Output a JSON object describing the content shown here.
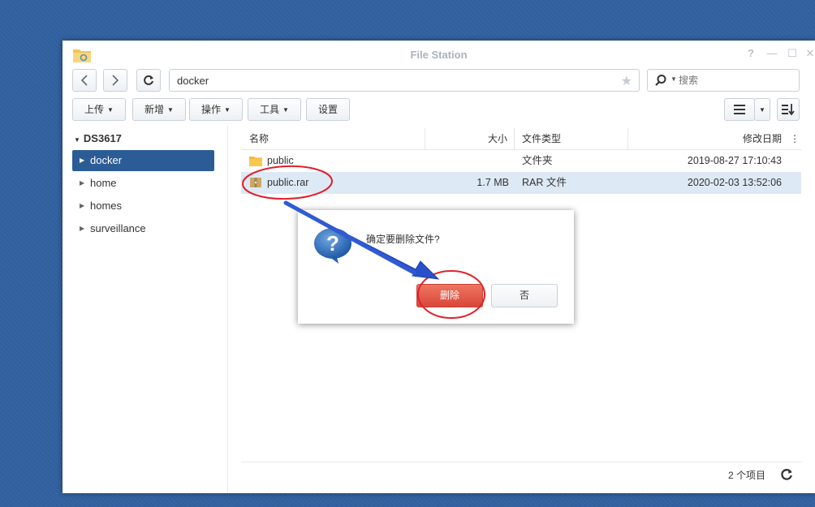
{
  "window": {
    "title": "File Station"
  },
  "navbar": {
    "path": "docker",
    "search_placeholder": "搜索"
  },
  "toolbar": {
    "upload": "上传",
    "create": "新增",
    "action": "操作",
    "tools": "工具",
    "settings": "设置"
  },
  "sidebar": {
    "root": "DS3617",
    "items": [
      {
        "label": "docker"
      },
      {
        "label": "home"
      },
      {
        "label": "homes"
      },
      {
        "label": "surveillance"
      }
    ]
  },
  "table": {
    "headers": {
      "name": "名称",
      "size": "大小",
      "type": "文件类型",
      "modified": "修改日期"
    },
    "rows": [
      {
        "name": "public",
        "size": "",
        "type": "文件夹",
        "modified": "2019-08-27 17:10:43"
      },
      {
        "name": "public.rar",
        "size": "1.7 MB",
        "type": "RAR 文件",
        "modified": "2020-02-03 13:52:06"
      }
    ]
  },
  "footer": {
    "count": "2 个项目"
  },
  "dialog": {
    "message": "确定要删除文件?",
    "delete_label": "删除",
    "no_label": "否"
  },
  "colors": {
    "accent": "#2b5c95",
    "danger": "#d9473a",
    "annotation_red": "#e0202a",
    "annotation_arrow": "#2850c8"
  }
}
